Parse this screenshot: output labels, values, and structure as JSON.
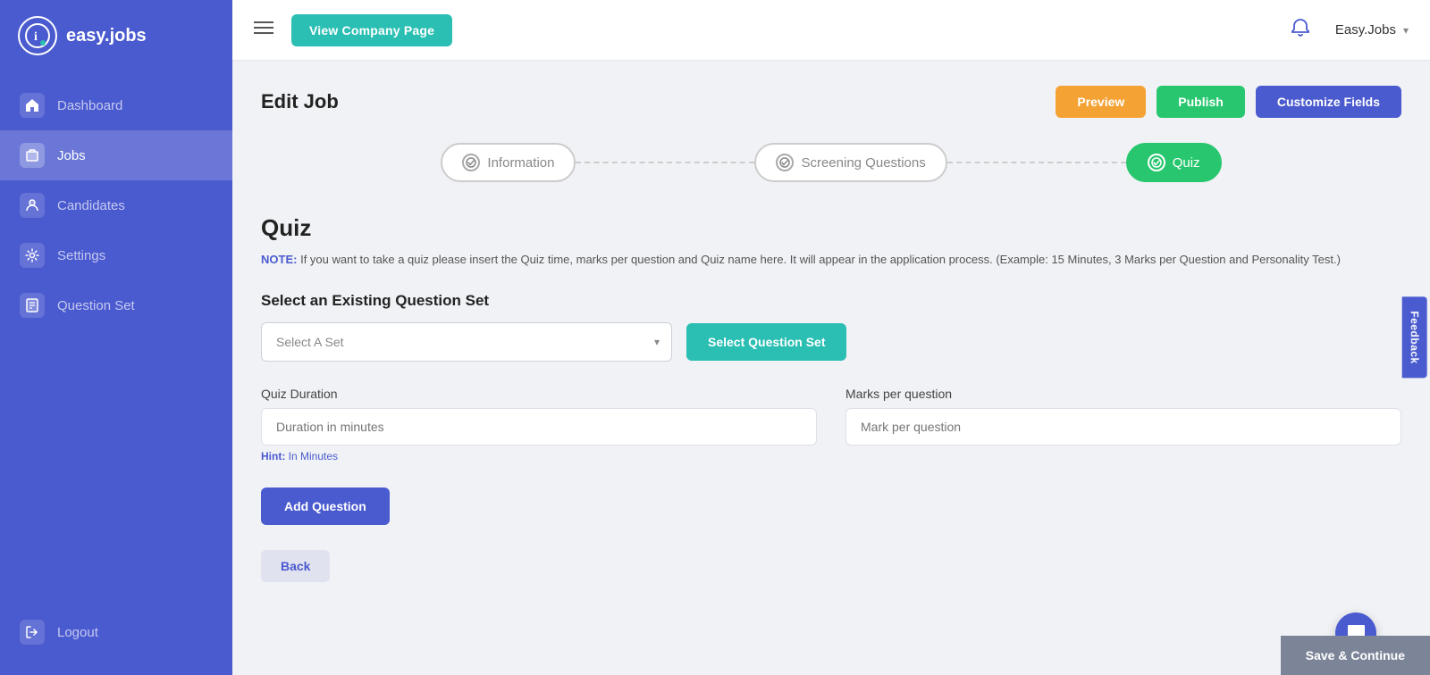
{
  "sidebar": {
    "logo_text": "easy.jobs",
    "logo_icon": "i",
    "items": [
      {
        "id": "dashboard",
        "label": "Dashboard",
        "icon": "⌂",
        "active": false
      },
      {
        "id": "jobs",
        "label": "Jobs",
        "icon": "💼",
        "active": true
      },
      {
        "id": "candidates",
        "label": "Candidates",
        "icon": "👤",
        "active": false
      },
      {
        "id": "settings",
        "label": "Settings",
        "icon": "⚙",
        "active": false
      },
      {
        "id": "question-set",
        "label": "Question Set",
        "icon": "📋",
        "active": false
      }
    ],
    "logout": "Logout",
    "logout_icon": "⇥"
  },
  "topbar": {
    "menu_icon": "☰",
    "view_company_label": "View Company Page",
    "user_name": "Easy.Jobs",
    "bell_icon": "🔔",
    "chevron": "▾"
  },
  "page": {
    "edit_job_title": "Edit Job",
    "btn_preview": "Preview",
    "btn_publish": "Publish",
    "btn_customize": "Customize Fields"
  },
  "steps": [
    {
      "id": "information",
      "label": "Information",
      "active": false
    },
    {
      "id": "screening-questions",
      "label": "Screening Questions",
      "active": false
    },
    {
      "id": "quiz",
      "label": "Quiz",
      "active": true
    }
  ],
  "quiz": {
    "title": "Quiz",
    "note_label": "NOTE:",
    "note_text": " If you want to take a quiz please insert the Quiz time, marks per question and Quiz name here. It will appear in the application process. (Example: 15 Minutes, 3 Marks per Question and Personality Test.)",
    "select_section_title": "Select an Existing Question Set",
    "select_placeholder": "Select A Set",
    "btn_select_question_set": "Select Question Set",
    "duration_label": "Quiz Duration",
    "duration_placeholder": "Duration in minutes",
    "duration_hint_label": "Hint:",
    "duration_hint_text": " In Minutes",
    "marks_label": "Marks per question",
    "marks_placeholder": "Mark per question",
    "btn_add_question": "Add Question",
    "btn_back": "Back",
    "btn_save_continue": "Save & Continue",
    "feedback_label": "Feedback"
  }
}
